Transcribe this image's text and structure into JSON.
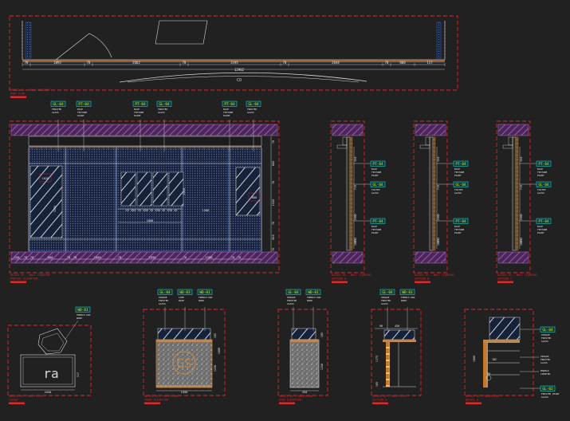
{
  "colors": {
    "background": "#212121",
    "frame": "#e0262b",
    "line": "#d9d9d9",
    "blue": "#3b6fd0",
    "tag": "#19c9c4",
    "tagText": "#e8e400",
    "dim": "#e6e6e6",
    "purple": "#7b3f8e",
    "orange": "#c8782a",
    "wood": "#b98a55"
  },
  "plan": {
    "dims": [
      "70",
      "1093",
      "70",
      "2662",
      "70",
      "3195",
      "70",
      "2644",
      "70",
      "800",
      "117"
    ],
    "overall": "12902",
    "title": "DETAIL 01 - WALL CLADDING",
    "subtitle": "PART PLAN"
  },
  "elevation": {
    "tags": [
      {
        "code": "GL-04",
        "note": [
          "FROSTED",
          "GLASS"
        ]
      },
      {
        "code": "PT-04",
        "note": [
          "BLUE",
          "TEXTURE",
          "PAINT"
        ]
      },
      {
        "code": "PT-04",
        "note": [
          "BLUE",
          "TEXTURE",
          "PAINT"
        ]
      },
      {
        "code": "GL-04",
        "note": [
          "FROSTED",
          "GLASS"
        ]
      },
      {
        "code": "PT-04",
        "note": [
          "BLUE",
          "TEXTURE",
          "PAINT"
        ]
      },
      {
        "code": "GL-04",
        "note": [
          "FROSTED",
          "GLASS"
        ]
      }
    ],
    "bottom_dims": [
      "150",
      "70",
      "70",
      "800",
      "70",
      "70",
      "1600",
      "70",
      "1850",
      "70",
      "1588",
      "70",
      "70"
    ],
    "right_dims": [
      "70",
      "800",
      "70",
      "1520",
      "70",
      "965",
      "70"
    ],
    "center_dims": "45 450 45 430 45 450 45 430 45",
    "span_dims": "1588",
    "width_dim": "1800",
    "height_dims": [
      "1620",
      "3135",
      "1430",
      "880"
    ],
    "title": "DETAIL 01 - WALL CLADDING",
    "subtitle": "PARTIAL ELEVATION"
  },
  "sections": [
    {
      "tags": [
        {
          "code": "PT-04",
          "note": [
            "BLUE",
            "TEXTURE",
            "PAINT"
          ]
        },
        {
          "code": "GL-04",
          "note": [
            "FLUTED",
            "GLASS"
          ]
        },
        {
          "code": "PT-04",
          "note": [
            "BLUE",
            "TEXTURE",
            "PAINT"
          ]
        }
      ],
      "dims": [
        "545",
        "715",
        "1500",
        "715",
        "1005"
      ],
      "title": "DETAIL 01 - WALL CLADDING",
      "subtitle": "SECTION A"
    },
    {
      "tags": [
        {
          "code": "PT-04",
          "note": [
            "BLUE",
            "TEXTURE",
            "PAINT"
          ]
        },
        {
          "code": "GL-04",
          "note": [
            "FLUTED",
            "GLASS"
          ]
        },
        {
          "code": "PT-04",
          "note": [
            "BLUE",
            "TEXTURE",
            "PAINT"
          ]
        }
      ],
      "dims": [
        "545",
        "715",
        "1500",
        "715",
        "1005"
      ],
      "title": "DETAIL 01 - WALL CLADDING",
      "subtitle": "SECTION B"
    },
    {
      "tags": [
        {
          "code": "PT-04",
          "note": [
            "BLUE",
            "TEXTURE",
            "PAINT"
          ]
        },
        {
          "code": "GL-04",
          "note": [
            "FLUTED",
            "GLASS"
          ]
        },
        {
          "code": "PT-04",
          "note": [
            "BLUE",
            "TEXTURE",
            "PAINT"
          ]
        }
      ],
      "dims": [
        "545",
        "715",
        "1500",
        "715",
        "1005"
      ],
      "title": "DETAIL 01 - WALL CLADDING",
      "subtitle": "SECTION C"
    }
  ],
  "details": [
    {
      "tags": [
        {
          "code": "WD-01",
          "note": [
            "FRENCH OAK",
            "WOOD"
          ]
        }
      ],
      "dims": [
        "1050",
        "317"
      ],
      "title": "DETAIL 02 - RECEPTION",
      "subtitle": "LAYOUT",
      "logo": "ra"
    },
    {
      "tags": [
        {
          "code": "GL-04",
          "note": [
            "OPAQUE",
            "FROSTED",
            "GLASS"
          ]
        },
        {
          "code": "WD-03",
          "note": [
            "LIME",
            "WASH"
          ]
        },
        {
          "code": "WD-01",
          "note": [
            "FRENCH OAK",
            "WOOD"
          ]
        }
      ],
      "dims": [
        "1050",
        "1250",
        "105",
        "1000"
      ],
      "title": "DETAIL 02 - RECEPTION",
      "subtitle": "FRONT ELEVATION",
      "logo": "GS"
    },
    {
      "tags": [
        {
          "code": "GL-04",
          "note": [
            "OPAQUE",
            "FROSTED",
            "GLASS"
          ]
        },
        {
          "code": "WD-01",
          "note": [
            "FRENCH OAK",
            "WOOD"
          ]
        }
      ],
      "dims": [
        "105",
        "1250",
        "450"
      ],
      "title": "DETAIL 02 - RECEPTION",
      "subtitle": "SIDE ELEVATION"
    },
    {
      "tags": [
        {
          "code": "GL-04",
          "note": [
            "OPAQUE",
            "FROSTED",
            "GLASS"
          ]
        },
        {
          "code": "WD-01",
          "note": [
            "FRENCH OAK",
            "WOOD"
          ]
        }
      ],
      "dims": [
        "90",
        "450",
        "1175",
        "105"
      ],
      "title": "DETAIL 02 - RECEPTION",
      "subtitle": "SECTION A"
    },
    {
      "tags": [
        {
          "code": "GL-04",
          "note": [
            "OPAQUE",
            "FROSTED",
            "GLASS"
          ]
        },
        {
          "code": "GL-02",
          "note": [
            "FROSTED PAINT",
            "GLASS"
          ]
        }
      ],
      "notes": [
        [
          "OPAQUE",
          "FROSTED",
          "GLASS"
        ],
        [
          "MARBLE",
          "COUNTER"
        ]
      ],
      "dims": [
        "1000",
        "102",
        "80"
      ],
      "title": "DETAIL 02 - RECEPTION",
      "subtitle": "DETAIL A"
    }
  ]
}
